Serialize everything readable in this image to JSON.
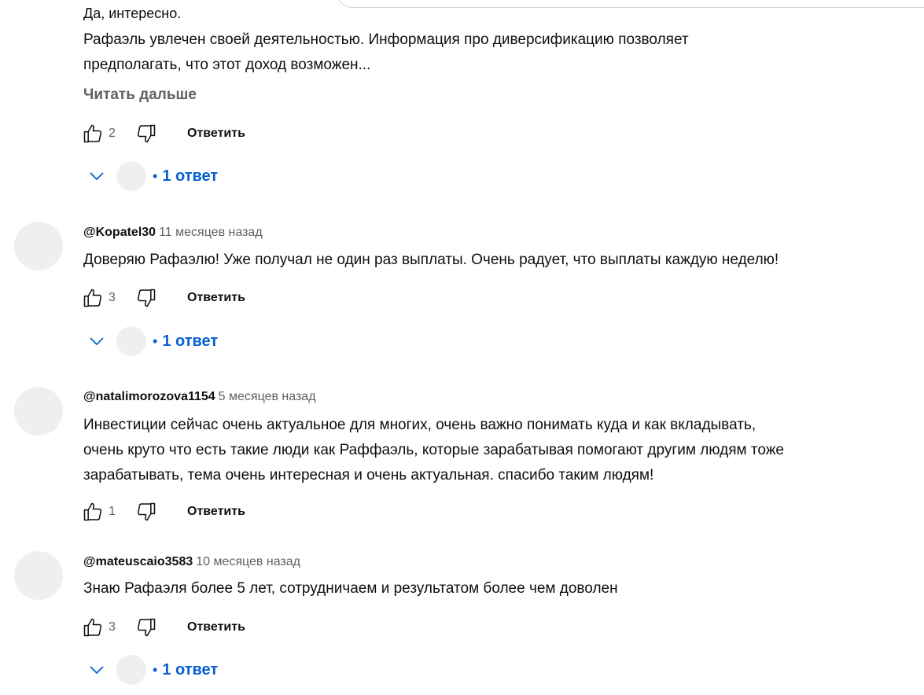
{
  "comments": [
    {
      "partial_top": "Да, интересно.",
      "lines": [
        "Рафаэль увлечен своей деятельностью. Информация про диверсификацию позволяет",
        "предполагать, что этот доход возможен..."
      ],
      "read_more": "Читать дальше",
      "likes": "2",
      "reply_label": "Ответить",
      "replies": "1 ответ"
    },
    {
      "author": "@Kopatel30",
      "time": "11 месяцев назад",
      "lines": [
        "Доверяю Рафаэлю! Уже получал не один раз выплаты. Очень радует, что выплаты каждую неделю!"
      ],
      "likes": "3",
      "reply_label": "Ответить",
      "replies": "1 ответ"
    },
    {
      "author": "@natalimorozova1154",
      "time": "5 месяцев назад",
      "lines": [
        "Инвестиции сейчас очень актуальное для многих, очень важно понимать куда и как вкладывать,",
        "очень круто что есть такие люди как Раффаэль, которые зарабатывая помогают другим людям тоже",
        "зарабатывать, тема очень интересная и очень актуальная. спасибо таким людям!"
      ],
      "likes": "1",
      "reply_label": "Ответить"
    },
    {
      "author": "@mateuscaio3583",
      "time": "10 месяцев назад",
      "lines": [
        "Знаю Рафаэля более 5 лет, сотрудничаем и результатом более чем доволен"
      ],
      "likes": "3",
      "reply_label": "Ответить",
      "replies": "1 ответ"
    }
  ],
  "reply_dot": "•",
  "icons": {
    "like": "thumb-up-icon",
    "dislike": "thumb-down-icon",
    "expand": "chevron-down-icon"
  },
  "colors": {
    "link_blue": "#065fd4",
    "secondary_text": "#606060",
    "avatar_placeholder": "#efefef"
  }
}
